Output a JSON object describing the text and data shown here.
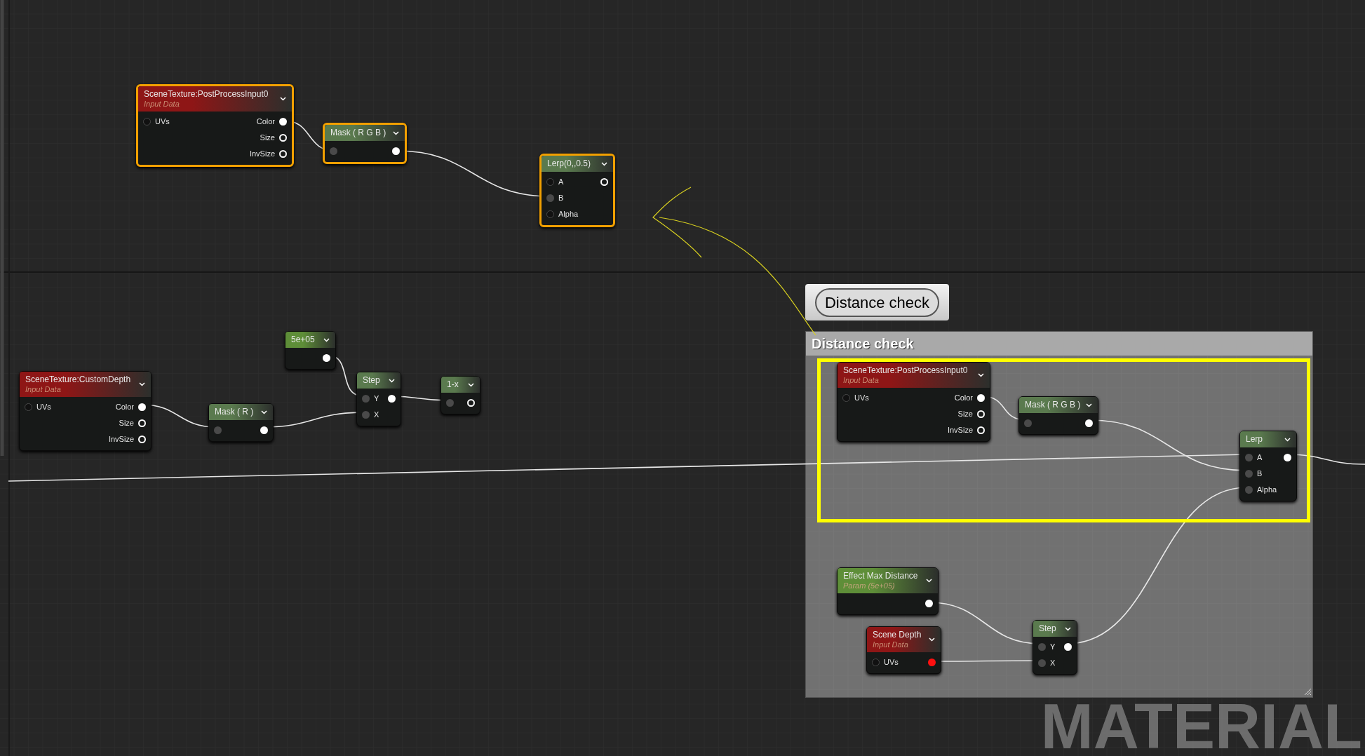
{
  "graph": {
    "nodes": [
      {
        "title": "SceneTexture:PostProcessInput0",
        "subtitle": "Input Data",
        "color": "#8e1616",
        "selected": true,
        "rows": [
          {
            "input": {
              "label": "UVs",
              "connected": false
            },
            "output": {
              "label": "Color",
              "connected": true
            }
          },
          {
            "output": {
              "label": "Size",
              "connected": false
            }
          },
          {
            "output": {
              "label": "InvSize",
              "connected": false
            }
          }
        ]
      },
      {
        "title": "Mask ( R G B )",
        "color": "#5a7a4e",
        "selected": true,
        "rows": [
          {
            "input": {
              "connected": true
            },
            "output": {
              "connected": true
            }
          }
        ]
      },
      {
        "title": "Lerp(0,,0.5)",
        "color": "#5a7a4e",
        "selected": true,
        "rows": [
          {
            "input": {
              "label": "A",
              "connected": false
            },
            "output": {
              "connected": false
            }
          },
          {
            "input": {
              "label": "B",
              "connected": true
            }
          },
          {
            "input": {
              "label": "Alpha",
              "connected": false
            }
          }
        ]
      },
      {
        "title": "5e+05",
        "color": "#5e8e38",
        "selected": false,
        "rows": [
          {
            "output": {
              "connected": true
            }
          }
        ]
      },
      {
        "title": "SceneTexture:CustomDepth",
        "subtitle": "Input Data",
        "color": "#8e1616",
        "selected": false,
        "rows": [
          {
            "input": {
              "label": "UVs",
              "connected": false
            },
            "output": {
              "label": "Color",
              "connected": true
            }
          },
          {
            "output": {
              "label": "Size",
              "connected": false
            }
          },
          {
            "output": {
              "label": "InvSize",
              "connected": false
            }
          }
        ]
      },
      {
        "title": "Mask ( R )",
        "color": "#5a7a4e",
        "selected": false,
        "rows": [
          {
            "input": {
              "connected": true
            },
            "output": {
              "connected": true
            }
          }
        ]
      },
      {
        "title": "Step",
        "color": "#5a7a4e",
        "selected": false,
        "rows": [
          {
            "input": {
              "label": "Y",
              "connected": true
            },
            "output": {
              "connected": true
            }
          },
          {
            "input": {
              "label": "X",
              "connected": true
            }
          }
        ]
      },
      {
        "title": "1-x",
        "color": "#5a7a4e",
        "selected": false,
        "rows": [
          {
            "input": {
              "connected": true
            },
            "output": {
              "connected": false
            }
          }
        ]
      }
    ]
  },
  "comment_tooltip": "Distance check",
  "comment": {
    "title": "Distance check",
    "nodes": [
      {
        "title": "SceneTexture:PostProcessInput0",
        "subtitle": "Input Data",
        "color": "#8e1616",
        "selected": false,
        "rows": [
          {
            "input": {
              "label": "UVs",
              "connected": false
            },
            "output": {
              "label": "Color",
              "connected": true
            }
          },
          {
            "output": {
              "label": "Size",
              "connected": false
            }
          },
          {
            "output": {
              "label": "InvSize",
              "connected": false
            }
          }
        ]
      },
      {
        "title": "Mask ( R G B )",
        "color": "#5a7a4e",
        "selected": false,
        "rows": [
          {
            "input": {
              "connected": true
            },
            "output": {
              "connected": true
            }
          }
        ]
      },
      {
        "title": "Lerp",
        "color": "#5a7a4e",
        "selected": false,
        "rows": [
          {
            "input": {
              "label": "A",
              "connected": true
            },
            "output": {
              "connected": true
            }
          },
          {
            "input": {
              "label": "B",
              "connected": true
            }
          },
          {
            "input": {
              "label": "Alpha",
              "connected": true
            }
          }
        ]
      },
      {
        "title": "Effect Max Distance",
        "subtitle": "Param (5e+05)",
        "color": "#5e8e38",
        "selected": false,
        "rows": [
          {
            "output": {
              "connected": true
            }
          }
        ]
      },
      {
        "title": "Scene Depth",
        "subtitle": "Input Data",
        "color": "#8e1616",
        "selected": false,
        "rows": [
          {
            "input": {
              "label": "UVs",
              "connected": false
            },
            "output": {
              "connected": true,
              "highlighted": true
            }
          }
        ]
      },
      {
        "title": "Step",
        "color": "#5a7a4e",
        "selected": false,
        "rows": [
          {
            "input": {
              "label": "Y",
              "connected": true
            },
            "output": {
              "connected": true
            }
          },
          {
            "input": {
              "label": "X",
              "connected": true
            }
          }
        ]
      }
    ]
  },
  "graph_type_label": "MATERIAL"
}
